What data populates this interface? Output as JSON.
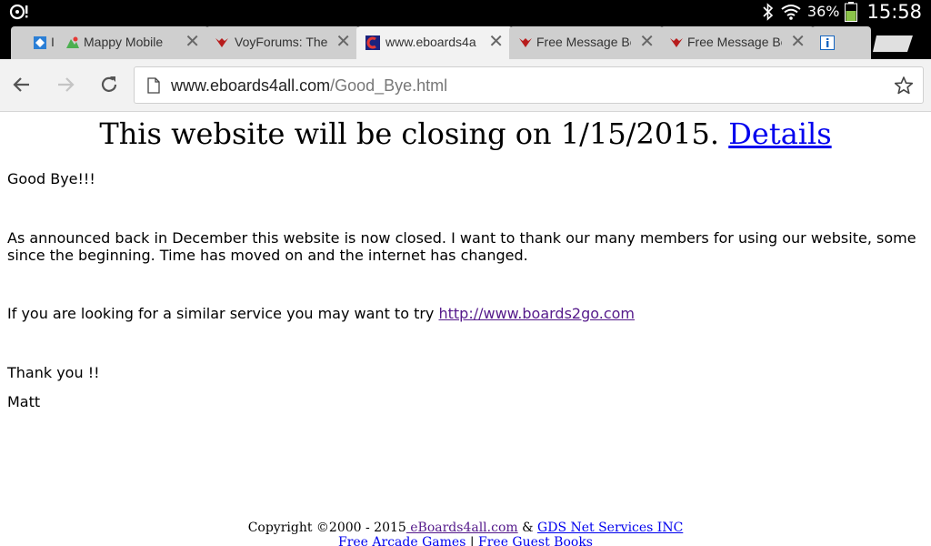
{
  "statusbar": {
    "battery_percent": "36%",
    "time": "15:58"
  },
  "tabs": [
    {
      "title": "I",
      "favicon": "puzzle-icon",
      "active": false
    },
    {
      "title": "Mappy Mobile",
      "favicon": "map-icon",
      "active": false
    },
    {
      "title": "VoyForums: The",
      "favicon": "eagle-icon",
      "active": false
    },
    {
      "title": "www.eboards4a",
      "favicon": "eboards-icon",
      "active": true
    },
    {
      "title": "Free Message Bo",
      "favicon": "eagle-icon",
      "active": false
    },
    {
      "title": "Free Message Bo",
      "favicon": "eagle-icon",
      "active": false
    },
    {
      "title": "",
      "favicon": "info-icon",
      "active": false
    }
  ],
  "omnibox": {
    "host": "www.eboards4all.com",
    "path": "/Good_Bye.html"
  },
  "page": {
    "banner_text": "This website will be closing on 1/15/2015. ",
    "banner_link": "Details",
    "goodbye": "Good Bye!!!",
    "announcement": "As announced back in December this website is now closed.  I want to thank our many members for using our website, some since the beginning.   Time has moved on and the internet has changed.",
    "similar_prefix": "If you are looking for a similar service you may want to try ",
    "similar_link": "http://www.boards2go.com",
    "thanks": "Thank you !!",
    "signature": "Matt"
  },
  "footer": {
    "copyright": "Copyright ©2000 - 2015",
    "link1": " eBoards4all.com",
    "amp": " & ",
    "link2": "GDS Net Services INC",
    "link3": "Free Arcade Games",
    "sep": " | ",
    "link4": "Free Guest Books"
  },
  "colors": {
    "link": "#0000ee",
    "visited_link": "#551a8b",
    "battery_green": "#8bc34a"
  }
}
